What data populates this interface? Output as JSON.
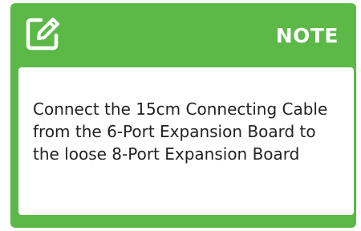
{
  "note": {
    "icon": "edit-note-icon",
    "title": "NOTE",
    "text": "Connect the 15cm Connecting Cable from the 6-Port Expansion Board to the loose 8-Port Expansion Board"
  },
  "colors": {
    "accent": "#5cb847",
    "panel": "#ffffff",
    "text": "#222222"
  }
}
